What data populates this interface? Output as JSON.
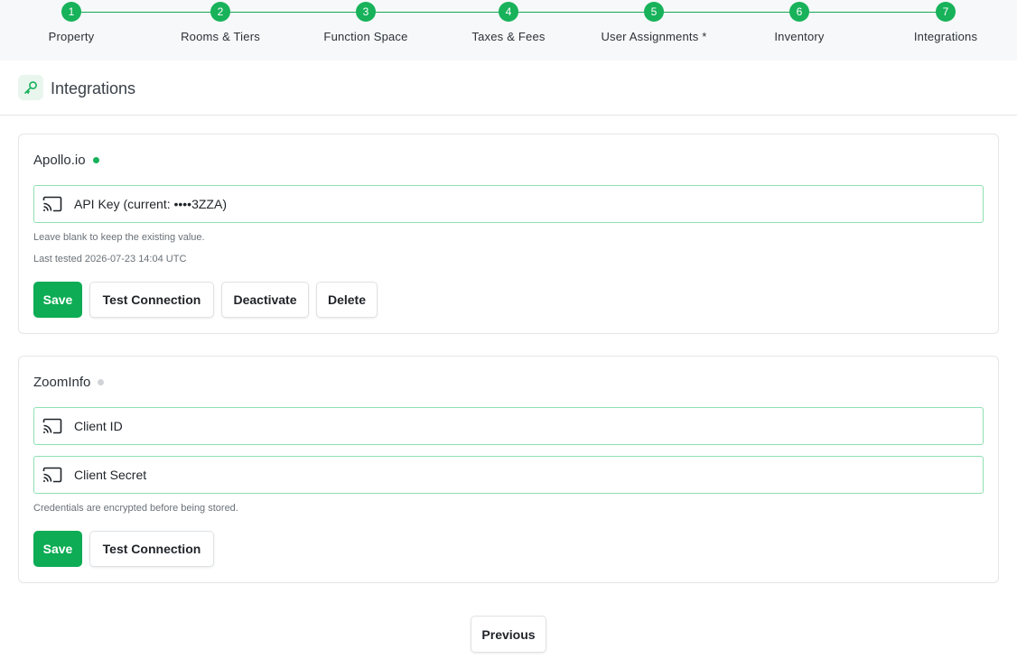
{
  "steps": [
    {
      "num": "1",
      "label": "Property"
    },
    {
      "num": "2",
      "label": "Rooms & Tiers"
    },
    {
      "num": "3",
      "label": "Function Space"
    },
    {
      "num": "4",
      "label": "Taxes & Fees"
    },
    {
      "num": "5",
      "label": "User Assignments *"
    },
    {
      "num": "6",
      "label": "Inventory"
    },
    {
      "num": "7",
      "label": "Integrations"
    }
  ],
  "header": {
    "title": "Integrations",
    "icon": "key-icon"
  },
  "apollo": {
    "name": "Apollo.io",
    "status_color": "#17b25a",
    "api_key_label": "API Key (current: ••••3ZZA)",
    "help_blank": "Leave blank to keep the existing value.",
    "last_tested": "Last tested 2026-07-23 14:04 UTC",
    "buttons": {
      "save": "Save",
      "test": "Test Connection",
      "deactivate": "Deactivate",
      "delete": "Delete"
    }
  },
  "zoominfo": {
    "name": "ZoomInfo",
    "status_color": "#d0d4d8",
    "client_id_label": "Client ID",
    "client_secret_label": "Client Secret",
    "help_encrypted": "Credentials are encrypted before being stored.",
    "buttons": {
      "save": "Save",
      "test": "Test Connection"
    }
  },
  "footer": {
    "previous": "Previous"
  },
  "colors": {
    "accent": "#0dac55",
    "field_border": "#8fe0b2"
  }
}
